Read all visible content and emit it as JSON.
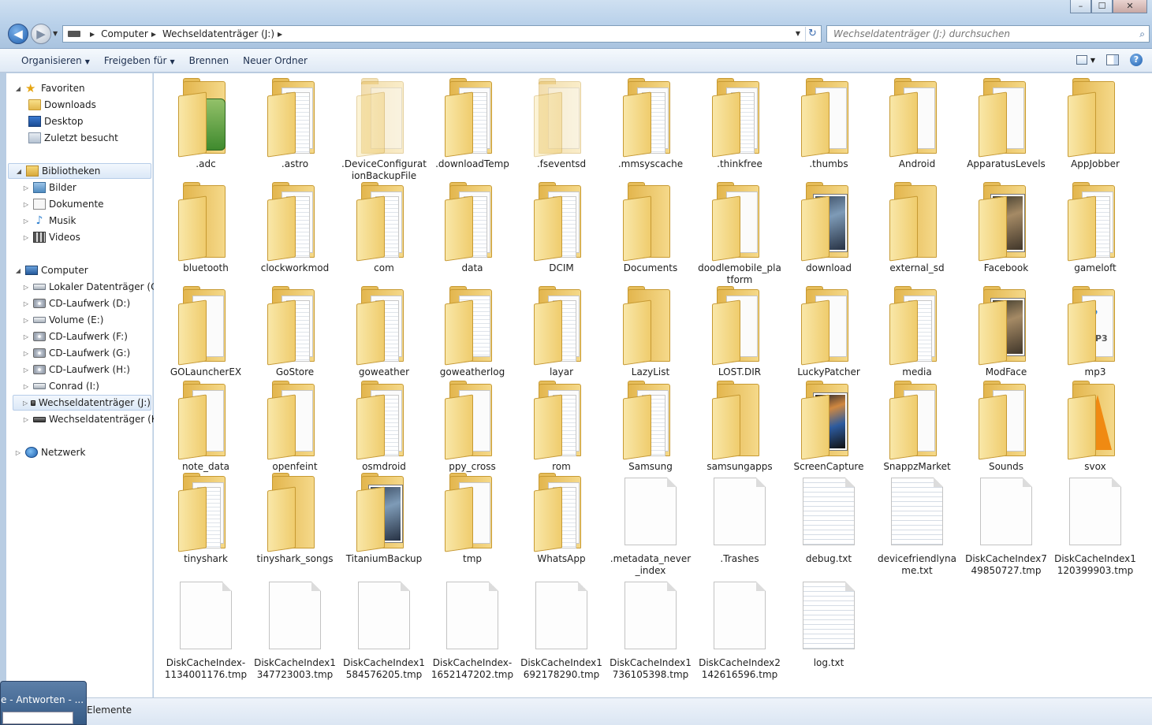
{
  "window": {
    "minimize": "–",
    "maximize": "☐",
    "close": "✕"
  },
  "address_bar": {
    "segments": [
      "Computer",
      "Wechseldatenträger (J:)"
    ],
    "search_placeholder": "Wechseldatenträger (J:) durchsuchen"
  },
  "toolbar": {
    "organize": "Organisieren",
    "share": "Freigeben für",
    "burn": "Brennen",
    "new_folder": "Neuer Ordner"
  },
  "nav": {
    "favorites": "Favoriten",
    "downloads": "Downloads",
    "desktop": "Desktop",
    "recent": "Zuletzt besucht",
    "libraries": "Bibliotheken",
    "pictures": "Bilder",
    "documents": "Dokumente",
    "music": "Musik",
    "videos": "Videos",
    "computer": "Computer",
    "drive_c": "Lokaler Datenträger (C:)",
    "drive_d": "CD-Laufwerk (D:)",
    "drive_e": "Volume (E:)",
    "drive_f": "CD-Laufwerk (F:)",
    "drive_g": "CD-Laufwerk (G:)",
    "drive_h": "CD-Laufwerk (H:)",
    "drive_i": "Conrad (I:)",
    "drive_j": "Wechseldatenträger (J:)",
    "drive_k": "Wechseldatenträger (K:)",
    "network": "Netzwerk"
  },
  "items": [
    {
      "name": ".adc",
      "type": "folder",
      "variant": "green"
    },
    {
      "name": ".astro",
      "type": "folder",
      "variant": "papers"
    },
    {
      "name": ".DeviceConfigurationBackupFile",
      "type": "folder",
      "variant": "faint"
    },
    {
      "name": ".downloadTemp",
      "type": "folder",
      "variant": "papers"
    },
    {
      "name": ".fseventsd",
      "type": "folder",
      "variant": "faint"
    },
    {
      "name": ".mmsyscache",
      "type": "folder",
      "variant": "papers"
    },
    {
      "name": ".thinkfree",
      "type": "folder",
      "variant": "papers"
    },
    {
      "name": ".thumbs",
      "type": "folder",
      "variant": "paper"
    },
    {
      "name": "Android",
      "type": "folder",
      "variant": "paper"
    },
    {
      "name": "ApparatusLevels",
      "type": "folder",
      "variant": "paper"
    },
    {
      "name": "AppJobber",
      "type": "folder",
      "variant": "empty"
    },
    {
      "name": "bluetooth",
      "type": "folder",
      "variant": "empty"
    },
    {
      "name": "clockworkmod",
      "type": "folder",
      "variant": "papers"
    },
    {
      "name": "com",
      "type": "folder",
      "variant": "papers"
    },
    {
      "name": "data",
      "type": "folder",
      "variant": "papers"
    },
    {
      "name": "DCIM",
      "type": "folder",
      "variant": "papers"
    },
    {
      "name": "Documents",
      "type": "folder",
      "variant": "empty"
    },
    {
      "name": "doodlemobile_platform",
      "type": "folder",
      "variant": "paper"
    },
    {
      "name": "download",
      "type": "folder",
      "variant": "photo"
    },
    {
      "name": "external_sd",
      "type": "folder",
      "variant": "empty"
    },
    {
      "name": "Facebook",
      "type": "folder",
      "variant": "photo-warm"
    },
    {
      "name": "gameloft",
      "type": "folder",
      "variant": "papers"
    },
    {
      "name": "GOLauncherEX",
      "type": "folder",
      "variant": "paper"
    },
    {
      "name": "GoStore",
      "type": "folder",
      "variant": "papers"
    },
    {
      "name": "goweather",
      "type": "folder",
      "variant": "papers"
    },
    {
      "name": "goweatherlog",
      "type": "folder",
      "variant": "lines"
    },
    {
      "name": "layar",
      "type": "folder",
      "variant": "papers"
    },
    {
      "name": "LazyList",
      "type": "folder",
      "variant": "empty"
    },
    {
      "name": "LOST.DIR",
      "type": "folder",
      "variant": "paper"
    },
    {
      "name": "LuckyPatcher",
      "type": "folder",
      "variant": "paper"
    },
    {
      "name": "media",
      "type": "folder",
      "variant": "papers"
    },
    {
      "name": "ModFace",
      "type": "folder",
      "variant": "photo-warm"
    },
    {
      "name": "mp3",
      "type": "folder",
      "variant": "mp3"
    },
    {
      "name": "note_data",
      "type": "folder",
      "variant": "paper"
    },
    {
      "name": "openfeint",
      "type": "folder",
      "variant": "paper"
    },
    {
      "name": "osmdroid",
      "type": "folder",
      "variant": "papers"
    },
    {
      "name": "ppy_cross",
      "type": "folder",
      "variant": "paper"
    },
    {
      "name": "rom",
      "type": "folder",
      "variant": "papers"
    },
    {
      "name": "Samsung",
      "type": "folder",
      "variant": "papers"
    },
    {
      "name": "samsungapps",
      "type": "folder",
      "variant": "empty"
    },
    {
      "name": "ScreenCapture",
      "type": "folder",
      "variant": "photo-phone"
    },
    {
      "name": "SnappzMarket",
      "type": "folder",
      "variant": "paper"
    },
    {
      "name": "Sounds",
      "type": "folder",
      "variant": "paper"
    },
    {
      "name": "svox",
      "type": "folder",
      "variant": "cone"
    },
    {
      "name": "tinyshark",
      "type": "folder",
      "variant": "papers"
    },
    {
      "name": "tinyshark_songs",
      "type": "folder",
      "variant": "empty"
    },
    {
      "name": "TitaniumBackup",
      "type": "folder",
      "variant": "photo"
    },
    {
      "name": "tmp",
      "type": "folder",
      "variant": "paper"
    },
    {
      "name": "WhatsApp",
      "type": "folder",
      "variant": "papers"
    },
    {
      "name": ".metadata_never_index",
      "type": "file",
      "variant": "blank"
    },
    {
      "name": ".Trashes",
      "type": "file",
      "variant": "blank"
    },
    {
      "name": "debug.txt",
      "type": "file",
      "variant": "lines"
    },
    {
      "name": "devicefriendlyname.txt",
      "type": "file",
      "variant": "lines"
    },
    {
      "name": "DiskCacheIndex749850727.tmp",
      "type": "file",
      "variant": "blank"
    },
    {
      "name": "DiskCacheIndex1120399903.tmp",
      "type": "file",
      "variant": "blank"
    },
    {
      "name": "DiskCacheIndex-1134001176.tmp",
      "type": "file",
      "variant": "blank"
    },
    {
      "name": "DiskCacheIndex1347723003.tmp",
      "type": "file",
      "variant": "blank"
    },
    {
      "name": "DiskCacheIndex1584576205.tmp",
      "type": "file",
      "variant": "blank"
    },
    {
      "name": "DiskCacheIndex-1652147202.tmp",
      "type": "file",
      "variant": "blank"
    },
    {
      "name": "DiskCacheIndex1692178290.tmp",
      "type": "file",
      "variant": "blank"
    },
    {
      "name": "DiskCacheIndex1736105398.tmp",
      "type": "file",
      "variant": "blank"
    },
    {
      "name": "DiskCacheIndex2142616596.tmp",
      "type": "file",
      "variant": "blank"
    },
    {
      "name": "log.txt",
      "type": "file",
      "variant": "lines"
    }
  ],
  "status": {
    "count_text": "Elemente",
    "taskbar_preview": "e - Antworten - ..."
  }
}
